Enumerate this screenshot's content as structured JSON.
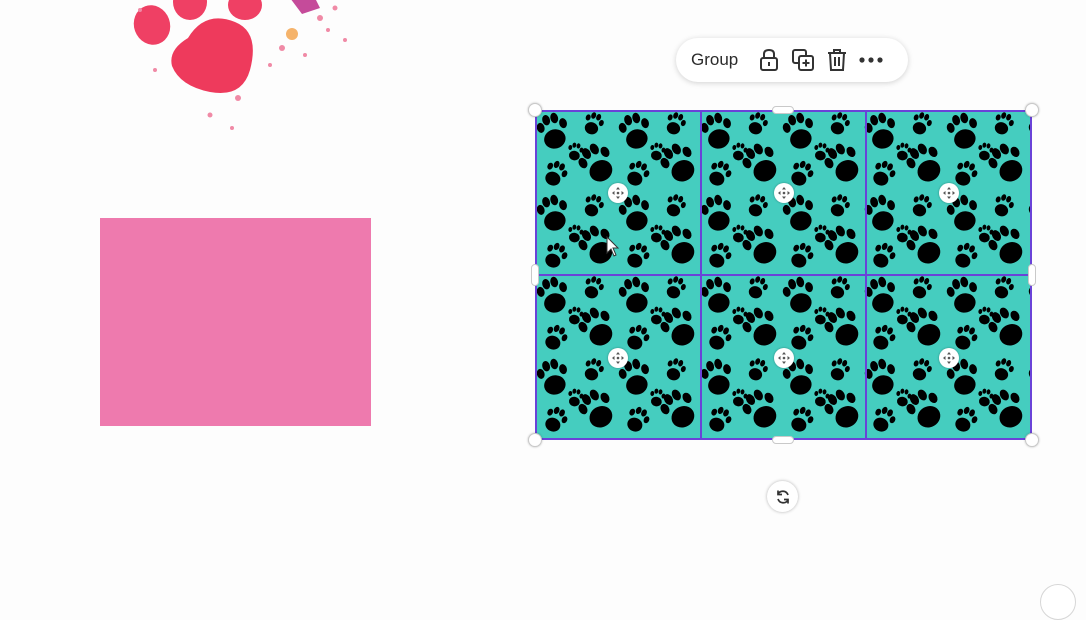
{
  "toolbar": {
    "group_label": "Group",
    "icons": [
      "lock-icon",
      "duplicate-icon",
      "trash-icon",
      "more-icon"
    ]
  },
  "colors": {
    "pink_rect": "#ee7aae",
    "pattern_bg": "#45cdbf",
    "paw": "#000000",
    "grid_line": "#6a43d8",
    "decor_paw": "#ef3f5f"
  },
  "grid": {
    "rows": 2,
    "cols": 3
  }
}
